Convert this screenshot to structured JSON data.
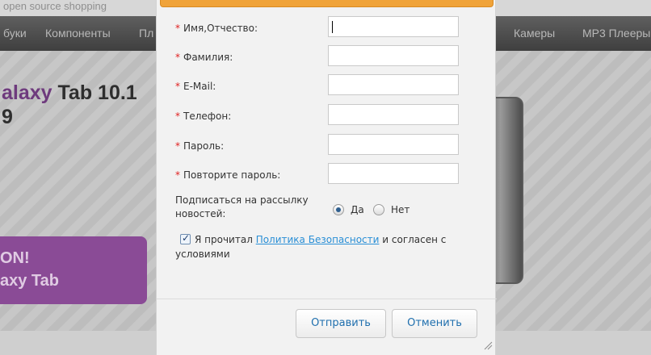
{
  "background": {
    "site_slogan": "open source shopping",
    "nav": [
      "буки",
      "Компоненты",
      "Пл",
      "Камеры",
      "MP3 Плееры"
    ],
    "banner_title_accent": "alaxy",
    "banner_title_rest": " Tab 10.1",
    "banner_title_line2": "9",
    "promo_line1": "ON!",
    "promo_line2": "axy Tab"
  },
  "form": {
    "fields": [
      {
        "label": "Имя,Отчество:",
        "value": "",
        "required": true
      },
      {
        "label": "Фамилия:",
        "value": "",
        "required": true
      },
      {
        "label": "E-Mail:",
        "value": "",
        "required": true
      },
      {
        "label": "Телефон:",
        "value": "",
        "required": true
      },
      {
        "label": "Пароль:",
        "value": "",
        "required": true
      },
      {
        "label": "Повторите пароль:",
        "value": "",
        "required": true
      }
    ],
    "required_mark": "*",
    "newsletter_label": "Подписаться на рассылку новостей:",
    "newsletter_options": [
      {
        "label": "Да",
        "selected": true
      },
      {
        "label": "Нет",
        "selected": false
      }
    ],
    "agree_checked": true,
    "agree_prefix": "Я прочитал",
    "agree_link": "Политика Безопасности",
    "agree_suffix": "и согласен с",
    "agree_line2": "условиями"
  },
  "buttons": {
    "submit": "Отправить",
    "cancel": "Отменить"
  },
  "colors": {
    "accent_orange": "#f0a33a",
    "link_blue": "#2a8fd6",
    "required_red": "#e02020"
  }
}
